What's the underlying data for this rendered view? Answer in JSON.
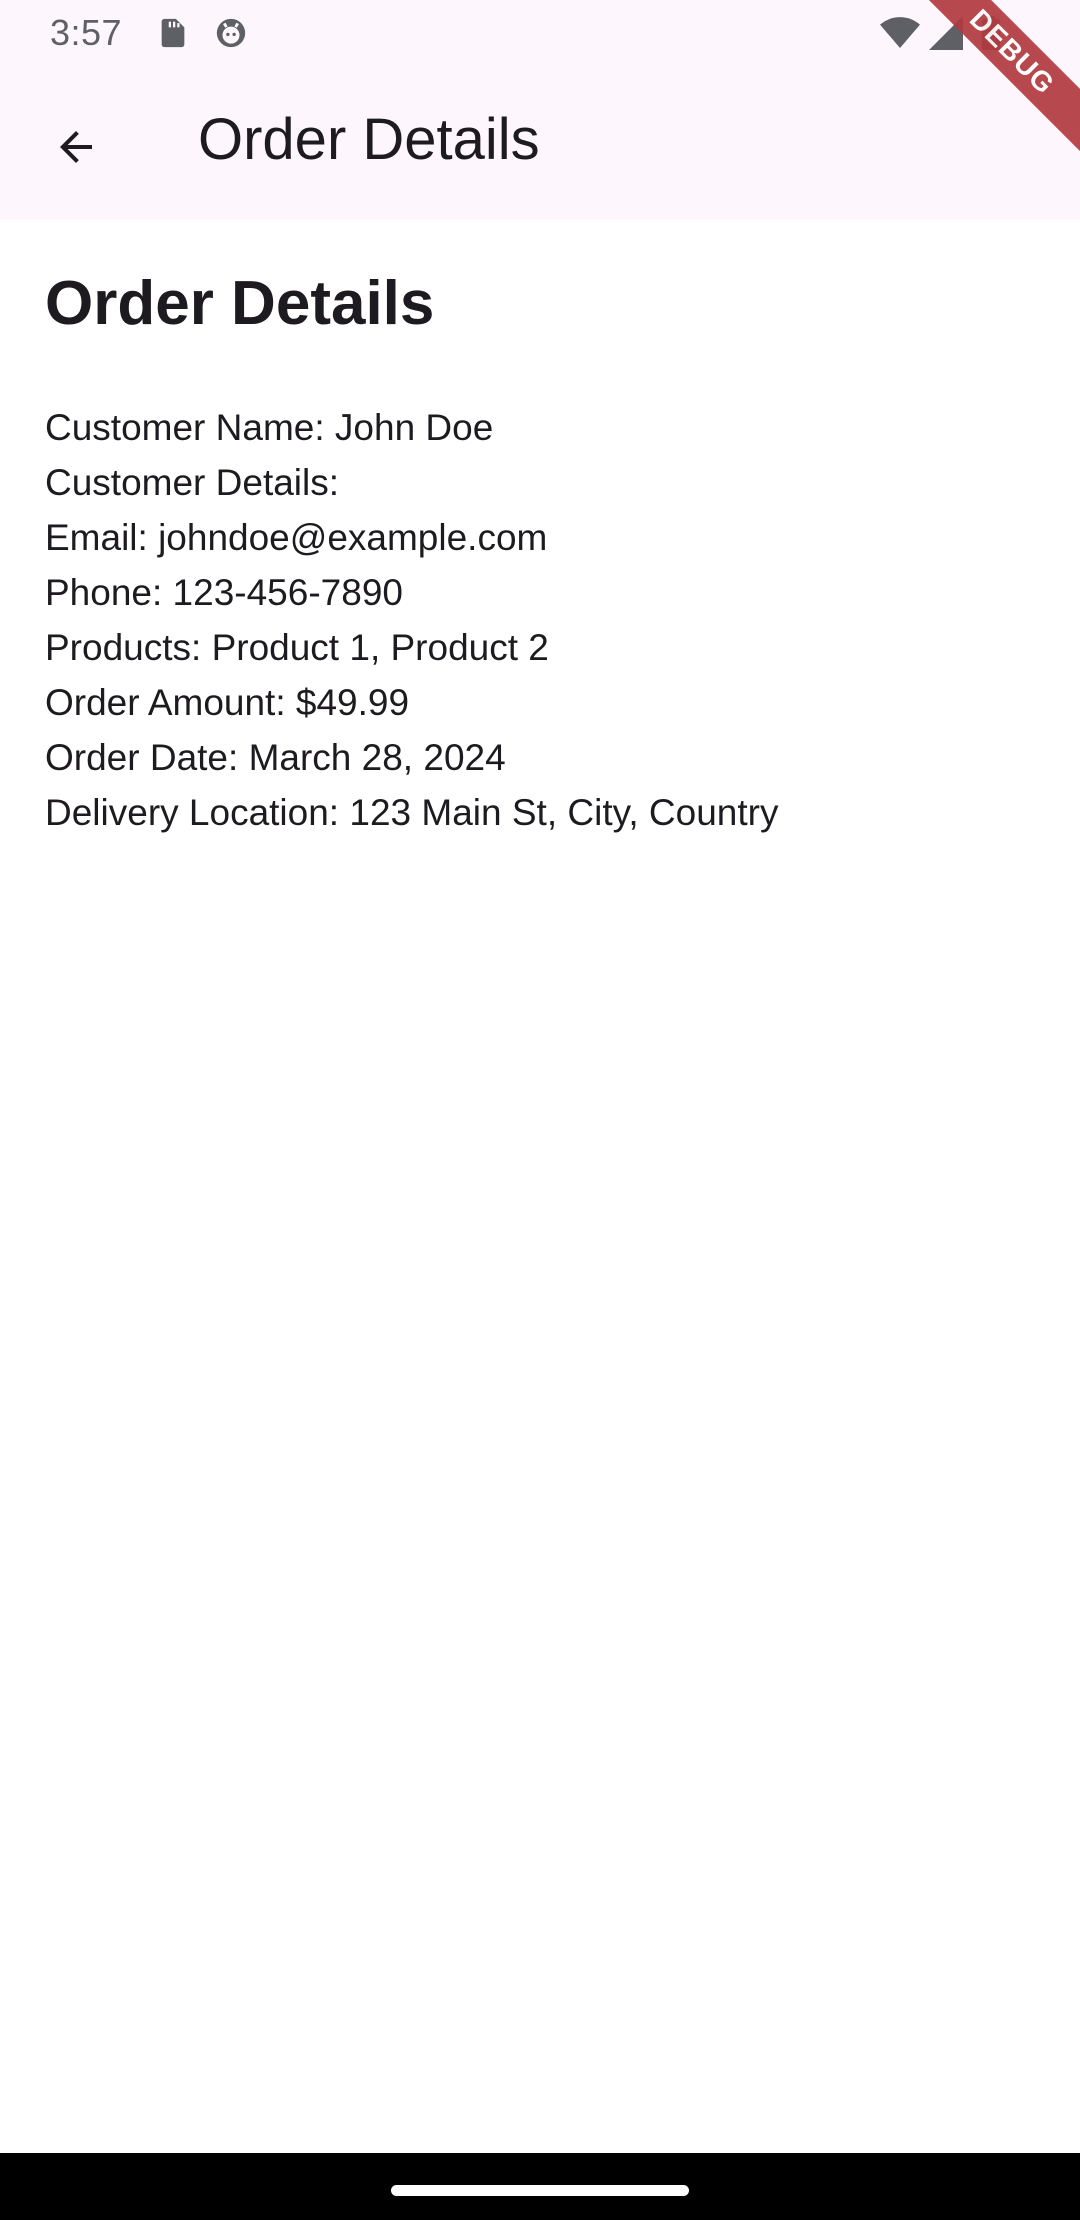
{
  "status_bar": {
    "time": "3:57",
    "icons": [
      "sd-card-icon",
      "android-debug-icon",
      "wifi-icon",
      "signal-icon",
      "battery-icon"
    ]
  },
  "debug_banner": "DEBUG",
  "app_bar": {
    "back_icon": "arrow-back-icon",
    "title": "Order Details"
  },
  "content": {
    "heading": "Order Details",
    "lines": [
      "Customer Name: John Doe",
      "Customer Details:",
      "Email: johndoe@example.com",
      "Phone: 123-456-7890",
      "Products: Product 1, Product 2",
      "Order Amount: $49.99",
      "Order Date: March 28, 2024",
      "Delivery Location: 123 Main St, City, Country"
    ]
  },
  "colors": {
    "app_bar_background": "#fdf7fd",
    "text": "#1d1b20",
    "debug_banner": "#b23a3f",
    "nav_bar": "#000000"
  }
}
